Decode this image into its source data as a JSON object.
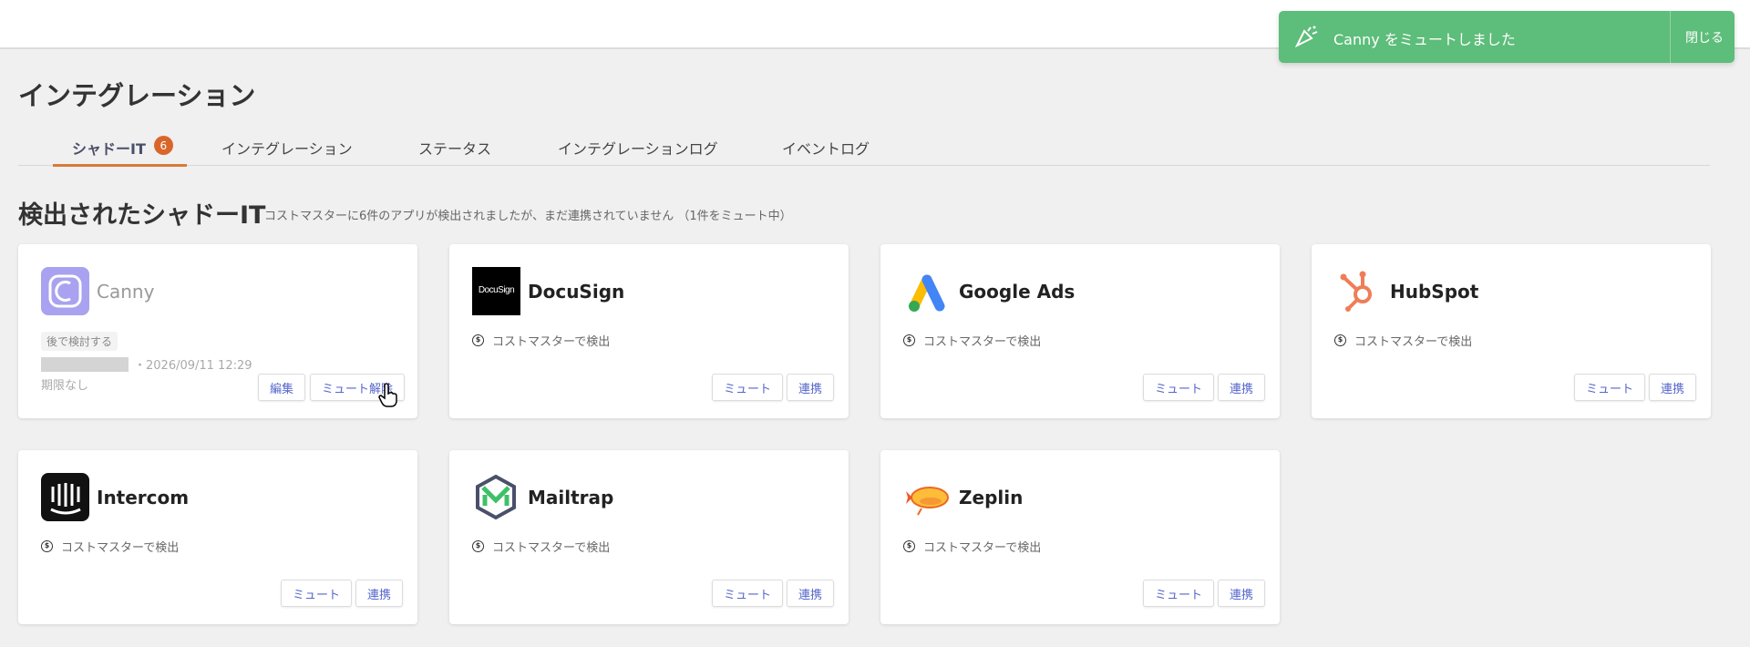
{
  "page_title": "インテグレーション",
  "tabs": [
    {
      "label": "シャドーIT",
      "badge": "6"
    },
    {
      "label": "インテグレーション"
    },
    {
      "label": "ステータス"
    },
    {
      "label": "インテグレーションログ"
    },
    {
      "label": "イベントログ"
    }
  ],
  "section": {
    "title": "検出されたシャドーIT",
    "subtitle": "コストマスターに6件のアプリが検出されましたが、まだ連携されていません （1件をミュート中）"
  },
  "cards": [
    {
      "name": "Canny",
      "logo": "canny-logo",
      "status_tag": "後で検討する",
      "date": "・2026/09/11 12:29",
      "deadline": "期限なし",
      "edit_label": "編集",
      "unmute_label": "ミュート解除"
    },
    {
      "name": "DocuSign",
      "logo": "docusign-logo",
      "logo_text": "DocuSign",
      "detected": "コストマスターで検出",
      "mute_label": "ミュート",
      "connect_label": "連携"
    },
    {
      "name": "Google Ads",
      "logo": "google-ads-logo",
      "detected": "コストマスターで検出",
      "mute_label": "ミュート",
      "connect_label": "連携"
    },
    {
      "name": "HubSpot",
      "logo": "hubspot-logo",
      "detected": "コストマスターで検出",
      "mute_label": "ミュート",
      "connect_label": "連携"
    },
    {
      "name": "Intercom",
      "logo": "intercom-logo",
      "detected": "コストマスターで検出",
      "mute_label": "ミュート",
      "connect_label": "連携"
    },
    {
      "name": "Mailtrap",
      "logo": "mailtrap-logo",
      "detected": "コストマスターで検出",
      "mute_label": "ミュート",
      "connect_label": "連携"
    },
    {
      "name": "Zeplin",
      "logo": "zeplin-logo",
      "detected": "コストマスターで検出",
      "mute_label": "ミュート",
      "connect_label": "連携"
    }
  ],
  "toast": {
    "message": "Canny をミュートしました",
    "close_label": "閉じる",
    "icon": "party-popper-icon"
  },
  "colors": {
    "accent_tab": "#d97a3a",
    "badge": "#d9652b",
    "toast": "#5dbd7a",
    "button_text": "#5566cc"
  }
}
